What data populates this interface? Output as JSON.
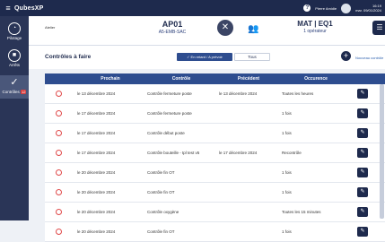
{
  "app": {
    "logo": "QubesXP",
    "menu_icon": "hamburger-icon"
  },
  "user": {
    "name": "Pierre Amidie",
    "time": "16:19",
    "date": "mar. 09/01/2024"
  },
  "sidebar": {
    "items": [
      {
        "label": "Pilotage",
        "icon": "gauge-icon"
      },
      {
        "label": "Arrêts",
        "icon": "stop-icon"
      },
      {
        "label": "Contrôles",
        "icon": "check-icon",
        "badge": "12"
      }
    ]
  },
  "header": {
    "small_label": "Atelier",
    "machine_title": "AP01",
    "machine_sub": "A5-EMB-SAC",
    "team_title": "MAT | EQ1",
    "team_sub": "1 opérateur"
  },
  "filters": {
    "title": "Contrôles à faire",
    "active": "✓ En retard / A prévoir",
    "all": "Tous",
    "new_label": "Nouveau contrôle"
  },
  "table": {
    "headers": [
      "Prochain",
      "Contrôle",
      "Précédent",
      "Occurence"
    ],
    "rows": [
      {
        "next": "le 13 décembre 2024",
        "control": "Contrôle fermeture poste",
        "prev": "le 13 décembre 2024",
        "occ": "Toutes les heures"
      },
      {
        "next": "le 17 décembre 2024",
        "control": "Contrôle fermeture poste",
        "prev": "",
        "occ": "1 fois"
      },
      {
        "next": "le 17 décembre 2024",
        "control": "Contrôle début poste",
        "prev": "",
        "occ": "1 fois"
      },
      {
        "next": "le 17 décembre 2024",
        "control": "Contrôle bouteille - tpl test v5",
        "prev": "le 17 décembre 2024",
        "occ": "Recontrôle"
      },
      {
        "next": "le 20 décembre 2024",
        "control": "Contrôle fin OT",
        "prev": "",
        "occ": "1 fois"
      },
      {
        "next": "le 20 décembre 2024",
        "control": "Contrôle fin OT",
        "prev": "",
        "occ": "1 fois"
      },
      {
        "next": "le 20 décembre 2024",
        "control": "Contrôle oxygène",
        "prev": "",
        "occ": "Toutes les 15 minutes"
      },
      {
        "next": "le 20 décembre 2024",
        "control": "Contrôle fin OT",
        "prev": "",
        "occ": "1 fois"
      }
    ]
  }
}
